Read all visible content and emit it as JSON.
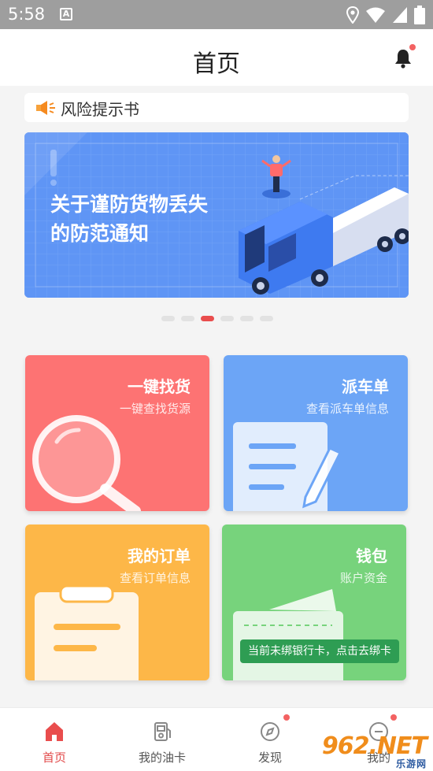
{
  "status_bar": {
    "time": "5:58",
    "notification_icon": "A"
  },
  "header": {
    "title": "首页"
  },
  "notice": {
    "label": "风险提示书"
  },
  "banner": {
    "headline_line1": "关于谨防货物丢失",
    "headline_line2": "的防范通知",
    "slide_count": 6,
    "active_slide": 3
  },
  "cards": {
    "find_goods": {
      "title": "一键找货",
      "subtitle": "一键查找货源",
      "color": "#fd7373"
    },
    "dispatch": {
      "title": "派车单",
      "subtitle": "查看派车单信息",
      "color": "#6ca5f6"
    },
    "orders": {
      "title": "我的订单",
      "subtitle": "查看订单信息",
      "color": "#fdb748"
    },
    "wallet": {
      "title": "钱包",
      "subtitle": "账户资金",
      "color": "#77d37c"
    }
  },
  "bind_tip": "当前未绑银行卡，点击去绑卡",
  "tabbar": {
    "items": [
      {
        "label": "首页",
        "icon": "home-icon",
        "active": true
      },
      {
        "label": "我的油卡",
        "icon": "fuel-card-icon",
        "active": false
      },
      {
        "label": "发现",
        "icon": "compass-icon",
        "active": false,
        "badge": true
      },
      {
        "label": "我的",
        "icon": "profile-icon",
        "active": false,
        "badge": true
      }
    ]
  },
  "watermark": {
    "big": "962.NET",
    "small": "乐游网"
  },
  "colors": {
    "accent": "#e94d4d",
    "badge": "#f36262"
  }
}
